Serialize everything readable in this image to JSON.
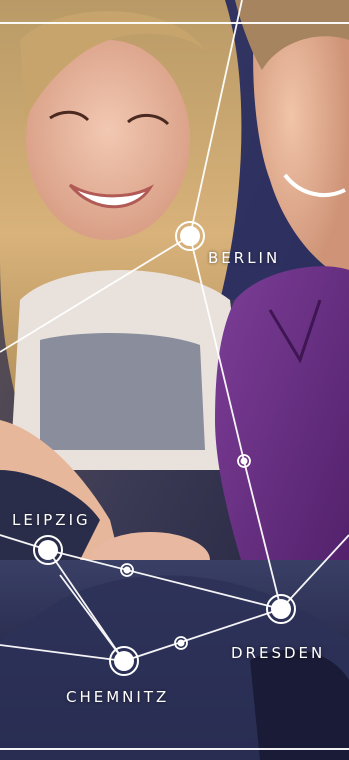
{
  "cities": {
    "berlin": "BERLIN",
    "leipzig": "LEIPZIG",
    "dresden": "DRESDEN",
    "chemnitz": "CHEMNITZ"
  },
  "photo": {
    "description_icon": "photo-two-people-with-phone"
  },
  "colors": {
    "line": "#ffffff",
    "node": "#ffffff",
    "shirt": "#6a2f83",
    "hair": "#c9a266"
  }
}
